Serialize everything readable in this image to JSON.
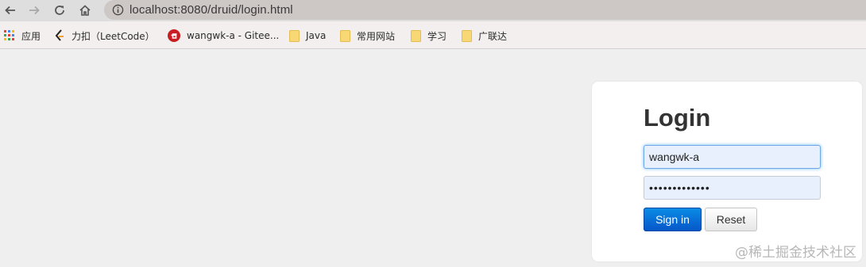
{
  "browser": {
    "url": "localhost:8080/druid/login.html",
    "bookmarks": [
      {
        "label": "应用",
        "icon": "apps-grid-icon"
      },
      {
        "label": "力扣（LeetCode）",
        "icon": "leetcode-icon"
      },
      {
        "label": "wangwk-a - Gitee...",
        "icon": "gitee-icon"
      },
      {
        "label": "Java",
        "icon": "folder-icon"
      },
      {
        "label": "常用网站",
        "icon": "folder-icon"
      },
      {
        "label": "学习",
        "icon": "folder-icon"
      },
      {
        "label": "广联达",
        "icon": "folder-icon"
      }
    ]
  },
  "login": {
    "title": "Login",
    "username": "wangwk-a",
    "password_mask": "•••••••••••••",
    "sign_in_label": "Sign in",
    "reset_label": "Reset"
  },
  "watermark": "@稀土掘金技术社区",
  "colors": {
    "primary_button": "#0a6fd8",
    "input_fill": "#e8f0fe",
    "page_bg": "#efefef"
  }
}
